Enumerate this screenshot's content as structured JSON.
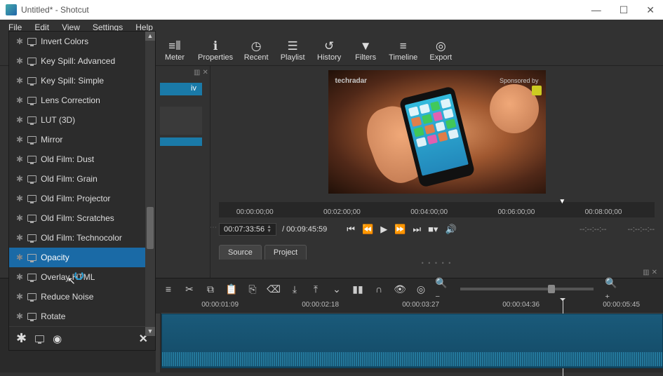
{
  "window": {
    "title": "Untitled* - Shotcut"
  },
  "menu": {
    "file": "File",
    "edit": "Edit",
    "view": "View",
    "settings": "Settings",
    "help": "Help"
  },
  "toolbar": {
    "meter": "Meter",
    "properties": "Properties",
    "recent": "Recent",
    "playlist": "Playlist",
    "history": "History",
    "filters": "Filters",
    "timeline": "Timeline",
    "export": "Export"
  },
  "filters": {
    "items": [
      "Invert Colors",
      "Key Spill: Advanced",
      "Key Spill: Simple",
      "Lens Correction",
      "LUT (3D)",
      "Mirror",
      "Old Film: Dust",
      "Old Film: Grain",
      "Old Film: Projector",
      "Old Film: Scratches",
      "Old Film: Technocolor",
      "Opacity",
      "Overlay HTML",
      "Reduce Noise",
      "Rotate"
    ],
    "selected_index": 11
  },
  "playlist": {
    "entry_suffix": "iv"
  },
  "preview": {
    "watermark_left": "techradar",
    "watermark_right": "Sponsored by",
    "ruler": [
      "00:00:00;00",
      "00:02:00;00",
      "00:04:00;00",
      "00:06:00;00",
      "00:08:00;00"
    ],
    "current_tc": "00:07:33:56",
    "total_tc": "/ 00:09:45:59",
    "inpoint": "--:--:--:--",
    "outpoint": "--:--:--:--",
    "tabs": {
      "source": "Source",
      "project": "Project"
    }
  },
  "timeline": {
    "ruler": [
      "00:00:01:09",
      "00:00:02:18",
      "00:00:03:27",
      "00:00:04:36",
      "00:00:05:45"
    ]
  }
}
